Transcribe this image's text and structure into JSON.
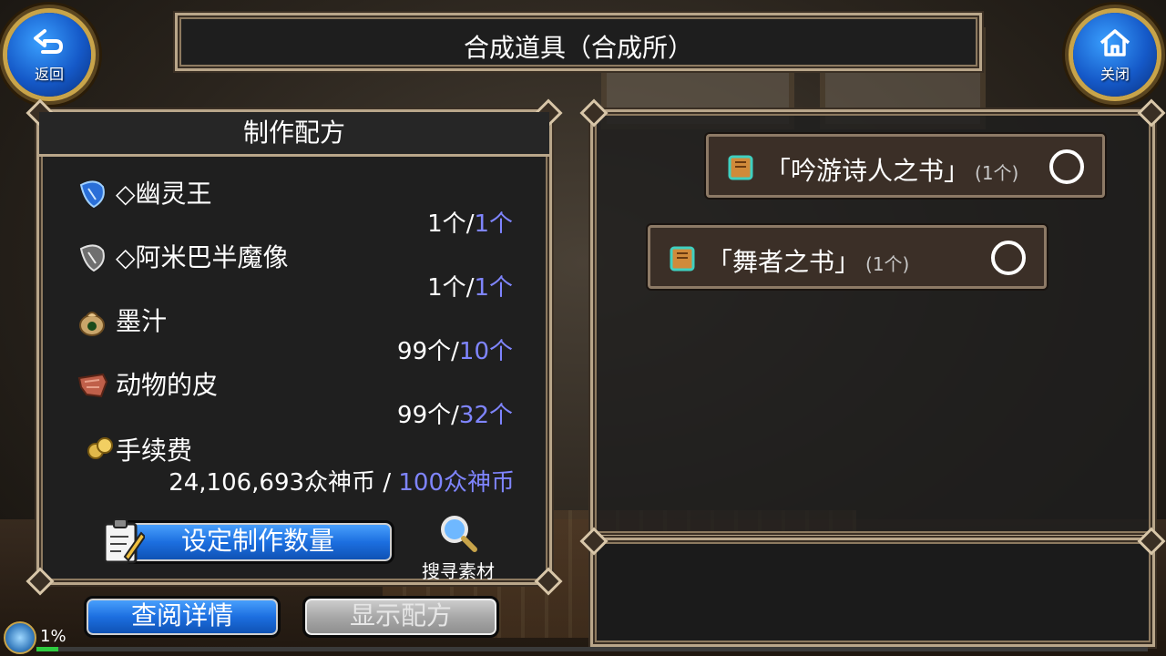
{
  "title": "合成道具（合成所）",
  "back_button": {
    "label": "返回"
  },
  "close_button": {
    "label": "关闭"
  },
  "recipe": {
    "header": "制作配方",
    "materials": [
      {
        "name": "◇幽灵王",
        "have": "1个",
        "sep": "/",
        "need": "1个",
        "icon": "blue-card-icon"
      },
      {
        "name": "◇阿米巴半魔像",
        "have": "1个",
        "sep": "/",
        "need": "1个",
        "icon": "gray-card-icon"
      },
      {
        "name": "墨汁",
        "have": "99个",
        "sep": "/",
        "need": "10个",
        "icon": "ink-bag-icon"
      },
      {
        "name": "动物的皮",
        "have": "99个",
        "sep": "/",
        "need": "32个",
        "icon": "animal-hide-icon"
      }
    ],
    "fee": {
      "label": "手续费",
      "have": "24,106,693众神币",
      "sep": " / ",
      "need": "100众神币",
      "icon": "coins-icon"
    },
    "set_quantity_button": "设定制作数量",
    "search_materials": "搜寻素材"
  },
  "view_details_button": "查阅详情",
  "show_recipe_button": "显示配方",
  "results": [
    {
      "name": "「吟游诗人之书」",
      "count": "(1个)",
      "icon": "book-icon"
    },
    {
      "name": "「舞者之书」",
      "count": "(1个)",
      "icon": "book-icon"
    }
  ],
  "status": {
    "percent_text": "1%",
    "progress": 0.01
  },
  "colors": {
    "need_text": "#7f85ff",
    "button_blue": "#1c6fe0",
    "frame": "#b9a68a"
  }
}
